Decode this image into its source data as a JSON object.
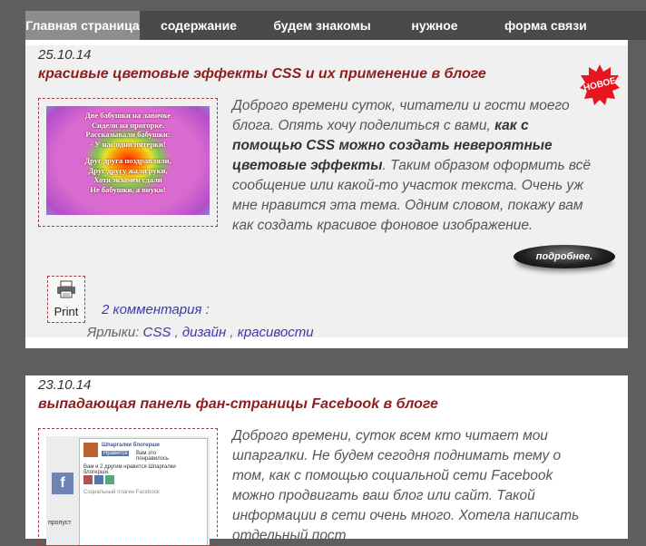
{
  "nav": {
    "items": [
      {
        "label": "Главная страница",
        "active": true
      },
      {
        "label": "содержание"
      },
      {
        "label": "будем знакомы"
      },
      {
        "label": "нужное"
      },
      {
        "label": "форма связи"
      }
    ]
  },
  "posts": [
    {
      "date": "25.10.14",
      "title": "красивые цветовые эффекты CSS и их применение в блоге",
      "badge": "НОВОЕ",
      "thumb_lines": [
        "Две бабушки на лавочке",
        "Сидели на пригорке.",
        "Рассказывали бабушки:",
        "- У нас одни пятерки!",
        "",
        "Друг друга поздравляли,",
        "Друг другу жали руки,",
        "Хотя экзамен сдали",
        "Не бабушки, а внуки!"
      ],
      "excerpt_pre": "Доброго времени суток, читатели и гости моего блога. Опять хочу поделиться с вами, ",
      "excerpt_bold": "как с помощью CSS можно создать невероятные цветовые эффекты",
      "excerpt_post": ". Таким образом оформить всё сообщение или какой-то участок текста. Очень уж мне нравится эта тема. Одним словом, покажу вам как создать красивое фоновое изображение.",
      "more_label": "подробнее.",
      "print_label": "Print",
      "comments": "2 комментария :",
      "labels_prefix": "Ярлыки:",
      "labels": [
        "CSS",
        "дизайн",
        "красивости"
      ],
      "labels_sep": ","
    },
    {
      "date": "23.10.14",
      "title": "выпадающая панель фан-страницы Facebook в блоге",
      "excerpt": "Доброго времени, суток всем кто читает мои шпаргалки. Не будем сегодня поднимать тему о том, как с помощью социальной сети Facebook можно продвигать ваш блог или сайт. Такой информации в сети очень много. Хотела написать отдельный пост",
      "fb": {
        "page_name": "Шпаргалки блогерши",
        "like_btn": "Нравится",
        "you_like": "Вам это понравилось",
        "friends_like": "Вам и 2 другим нравится Шпаргалки блогерши.",
        "plugin": "Социальный плагин Facebook",
        "skip": "пропуст"
      }
    }
  ],
  "colors": {
    "background": "#5e5e5e",
    "nav": "#4a4a4a",
    "nav_active": "#8d8d8d",
    "title": "#8e1e1e",
    "link": "#3a3aa8",
    "badge": "#e8141e"
  }
}
